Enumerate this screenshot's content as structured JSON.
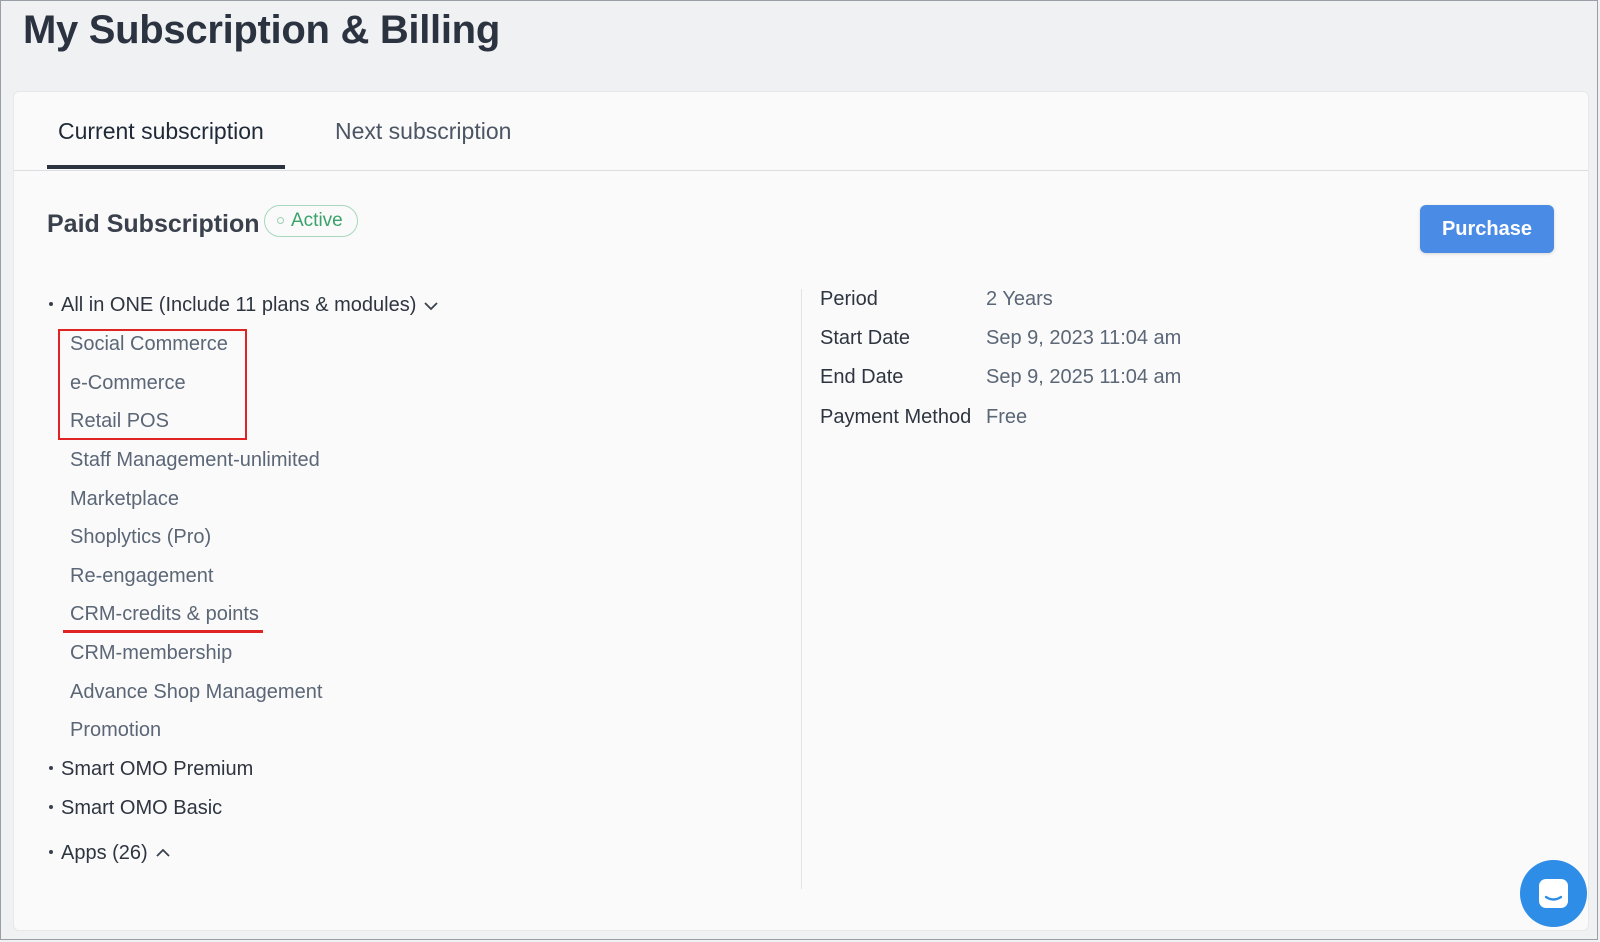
{
  "page": {
    "title": "My Subscription & Billing"
  },
  "tabs": [
    {
      "label": "Current subscription",
      "active": true
    },
    {
      "label": "Next subscription",
      "active": false
    }
  ],
  "subscription": {
    "title": "Paid Subscription",
    "status": "Active",
    "purchase_label": "Purchase",
    "plan": {
      "label": "All in ONE (Include 11 plans & modules)",
      "modules": [
        "Social Commerce",
        "e-Commerce",
        "Retail POS",
        "Staff Management-unlimited",
        "Marketplace",
        "Shoplytics (Pro)",
        "Re-engagement",
        "CRM-credits & points",
        "CRM-membership",
        "Advance Shop Management",
        "Promotion"
      ]
    },
    "other_plans": [
      "Smart OMO Premium",
      "Smart OMO Basic"
    ],
    "apps_label": "Apps (26)"
  },
  "details": [
    {
      "label": "Period",
      "value": "2 Years"
    },
    {
      "label": "Start Date",
      "value": "Sep 9, 2023 11:04 am"
    },
    {
      "label": "End Date",
      "value": "Sep 9, 2025 11:04 am"
    },
    {
      "label": "Payment Method",
      "value": "Free"
    }
  ],
  "colors": {
    "accent": "#4a8be6",
    "active_badge": "#3aa36a",
    "annotation": "#e02424",
    "chat": "#2e8de6"
  },
  "icons": [
    "chevron-down-icon",
    "chevron-up-icon",
    "chat-icon"
  ]
}
